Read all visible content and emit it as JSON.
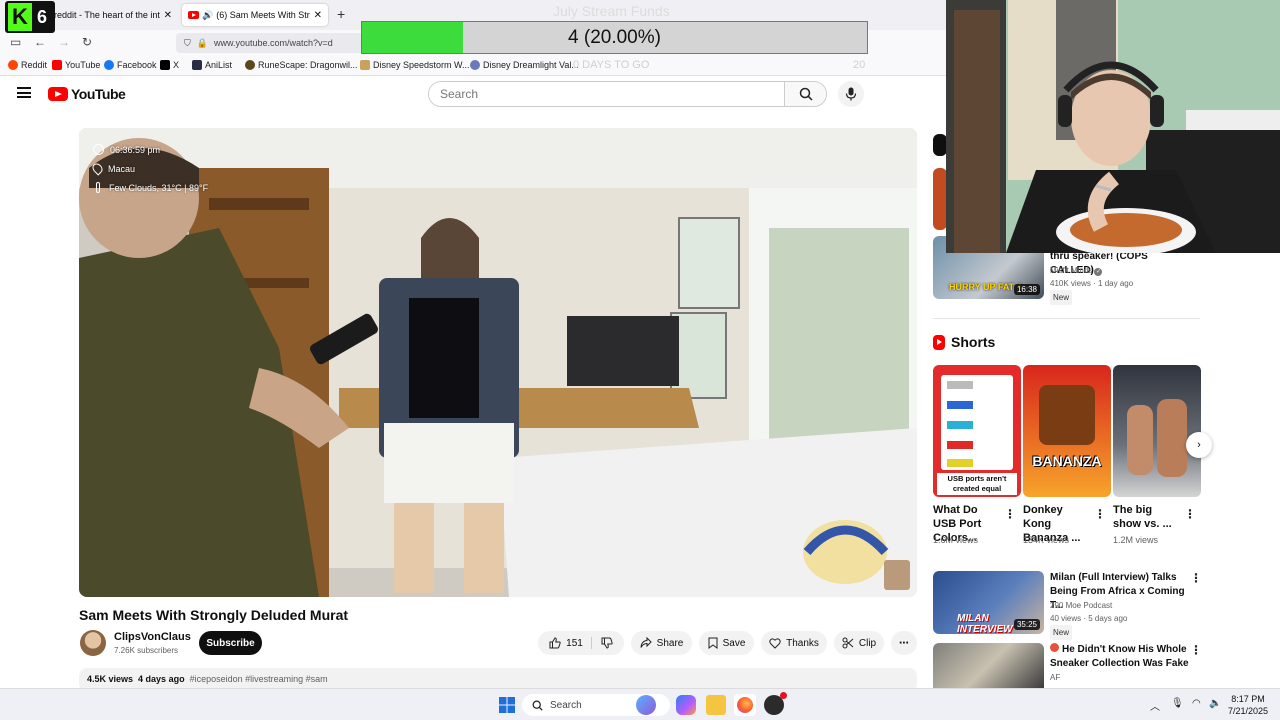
{
  "browser": {
    "tabs": [
      {
        "title": "reddit - The heart of the internet",
        "active": false
      },
      {
        "title": "(6) Sam Meets With Strongly Deluded Murat",
        "active": true
      }
    ],
    "url": "www.youtube.com/watch?v=d",
    "bookmarks": [
      {
        "label": "Reddit",
        "color": "#ff4500"
      },
      {
        "label": "YouTube",
        "color": "#ff0000"
      },
      {
        "label": "Facebook",
        "color": "#1877f2"
      },
      {
        "label": "X",
        "color": "#000000"
      },
      {
        "label": "AniList",
        "color": "#2b2d42"
      },
      {
        "label": "RuneScape: Dragonwil...",
        "color": "#5a4a1a"
      },
      {
        "label": "Disney Speedstorm W...",
        "color": "#c9a25b"
      },
      {
        "label": "Disney Dreamlight Val...",
        "color": "#6b7bb8"
      }
    ]
  },
  "overlay": {
    "kick_count": "6",
    "funds_title": "July Stream Funds",
    "funds_text": "4 (20.00%)",
    "funds_progress": 0.2,
    "days_left": "0 DAYS TO GO",
    "goal": "20",
    "accent": "#3ddc3d"
  },
  "youtube": {
    "logo": "YouTube",
    "search_placeholder": "Search",
    "video": {
      "title": "Sam Meets With Strongly Deluded Murat",
      "time": "06:36:59 pm",
      "location": "Macau",
      "weather": "Few Clouds, 31°C | 89°F",
      "channel": "ClipsVonClaus",
      "subscribers": "7.26K subscribers",
      "subscribe_label": "Subscribe",
      "likes": "151",
      "share_label": "Share",
      "save_label": "Save",
      "thanks_label": "Thanks",
      "clip_label": "Clip",
      "views": "4.5K views",
      "age": "4 days ago",
      "hashtags": "#iceposeidon #livestreaming #sam"
    },
    "sidebar": {
      "partial_video": {
        "title": "thru speaker! (COPS CALLED)",
        "channel": "Misfit Minds",
        "meta": "410K views · 1 day ago",
        "badge": "New",
        "duration": "16:38",
        "thumb_caption": "HURRY UP FAT A"
      },
      "shorts_label": "Shorts",
      "shorts": [
        {
          "title": "What Do USB Port Colors...",
          "views": "1.6M views",
          "caption": "USB ports aren't created equal"
        },
        {
          "title": "Donkey Kong Bananza ...",
          "views": "134K views",
          "caption": "BANANZA"
        },
        {
          "title": "The big show vs. ...",
          "views": "1.2M views",
          "caption": ""
        }
      ],
      "videos": [
        {
          "title": "Milan (Full Interview) Talks Being From Africa x Coming T...",
          "channel": "290 Moe Podcast",
          "meta": "40 views · 5 days ago",
          "badge": "New",
          "duration": "35:25",
          "thumb_caption": "MILAN INTERVIEW"
        },
        {
          "title": "He Didn't Know His Whole Sneaker Collection Was Fake",
          "channel": "AF",
          "meta": "",
          "badge": "",
          "duration": "",
          "thumb_caption": ""
        }
      ]
    }
  },
  "taskbar": {
    "search_placeholder": "Search",
    "time": "8:17 PM",
    "date": "7/21/2025"
  }
}
